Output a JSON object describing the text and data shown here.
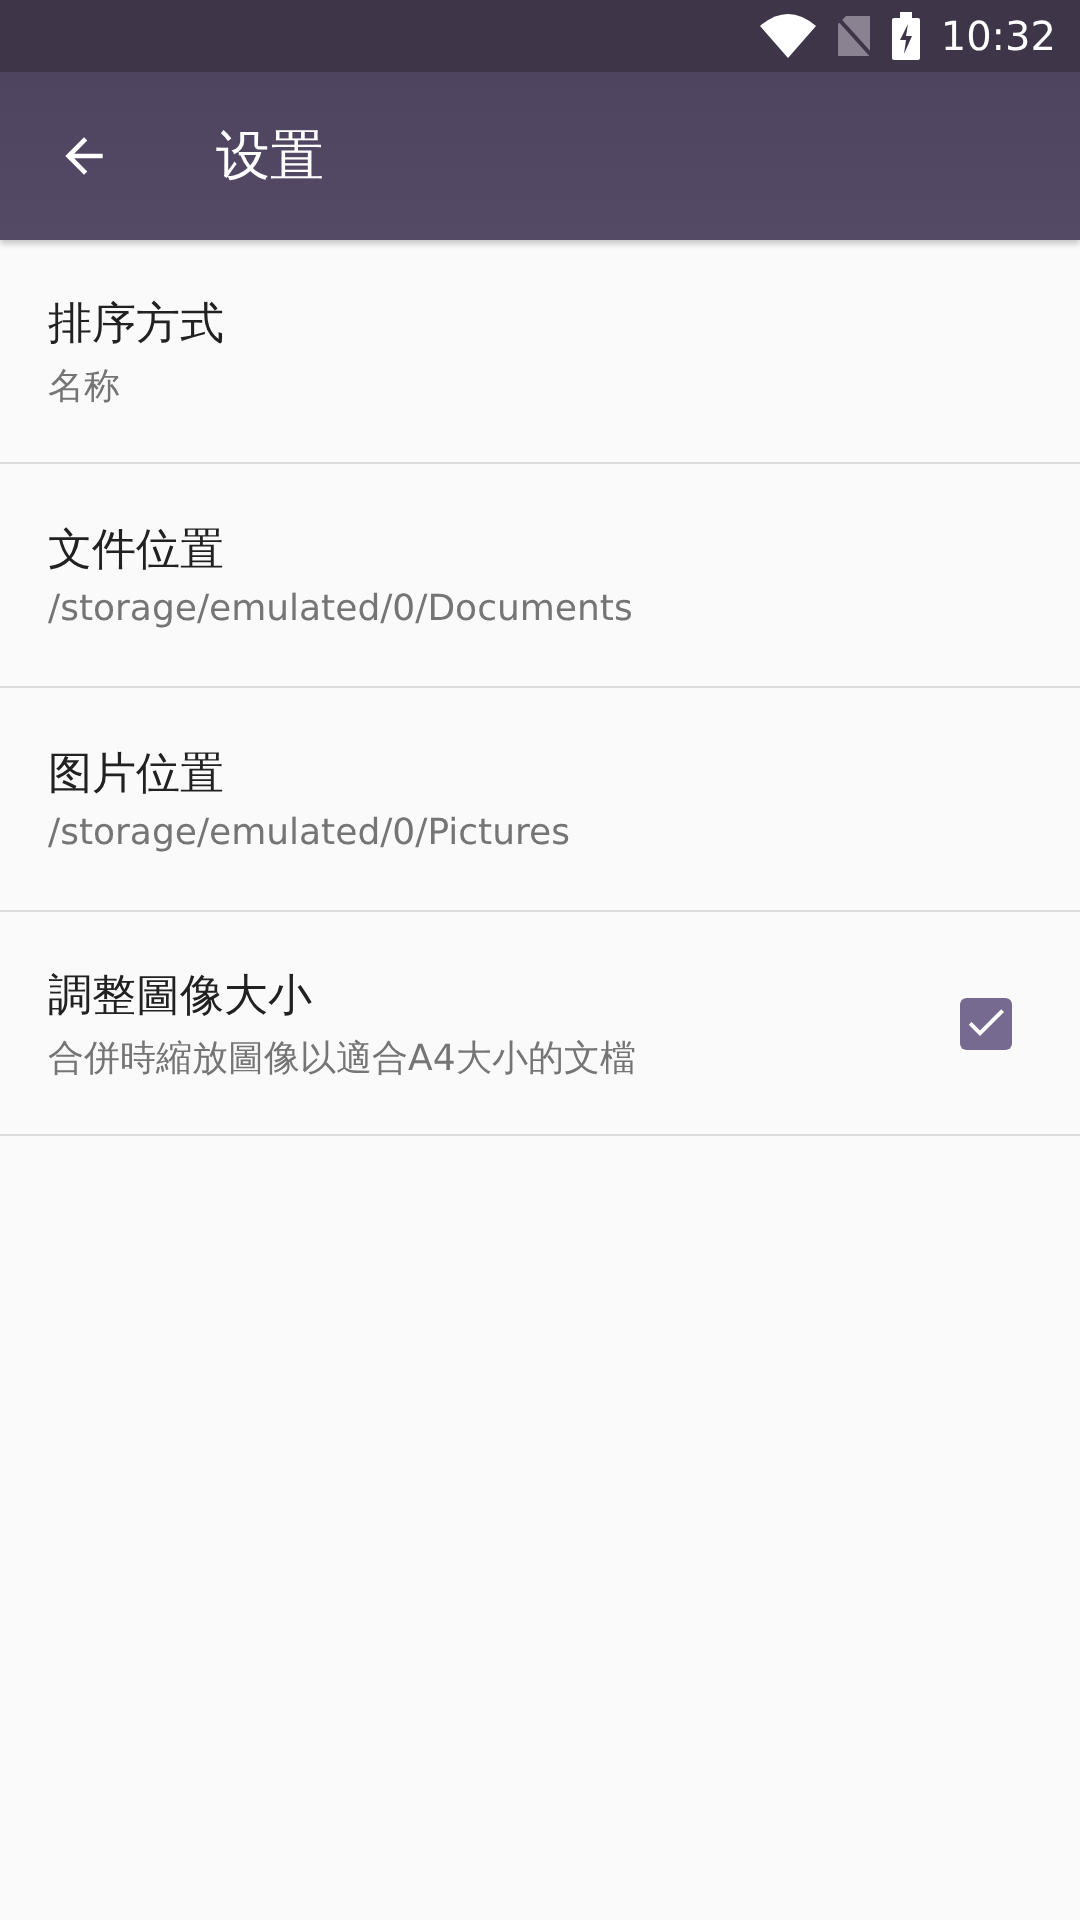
{
  "status_bar": {
    "time": "10:32"
  },
  "toolbar": {
    "title": "设置"
  },
  "settings": [
    {
      "title": "排序方式",
      "summary": "名称"
    },
    {
      "title": "文件位置",
      "summary": "/storage/emulated/0/Documents"
    },
    {
      "title": "图片位置",
      "summary": "/storage/emulated/0/Pictures"
    },
    {
      "title": "調整圖像大小",
      "summary": "合併時縮放圖像以適合A4大小的文檔",
      "checked": true
    }
  ]
}
